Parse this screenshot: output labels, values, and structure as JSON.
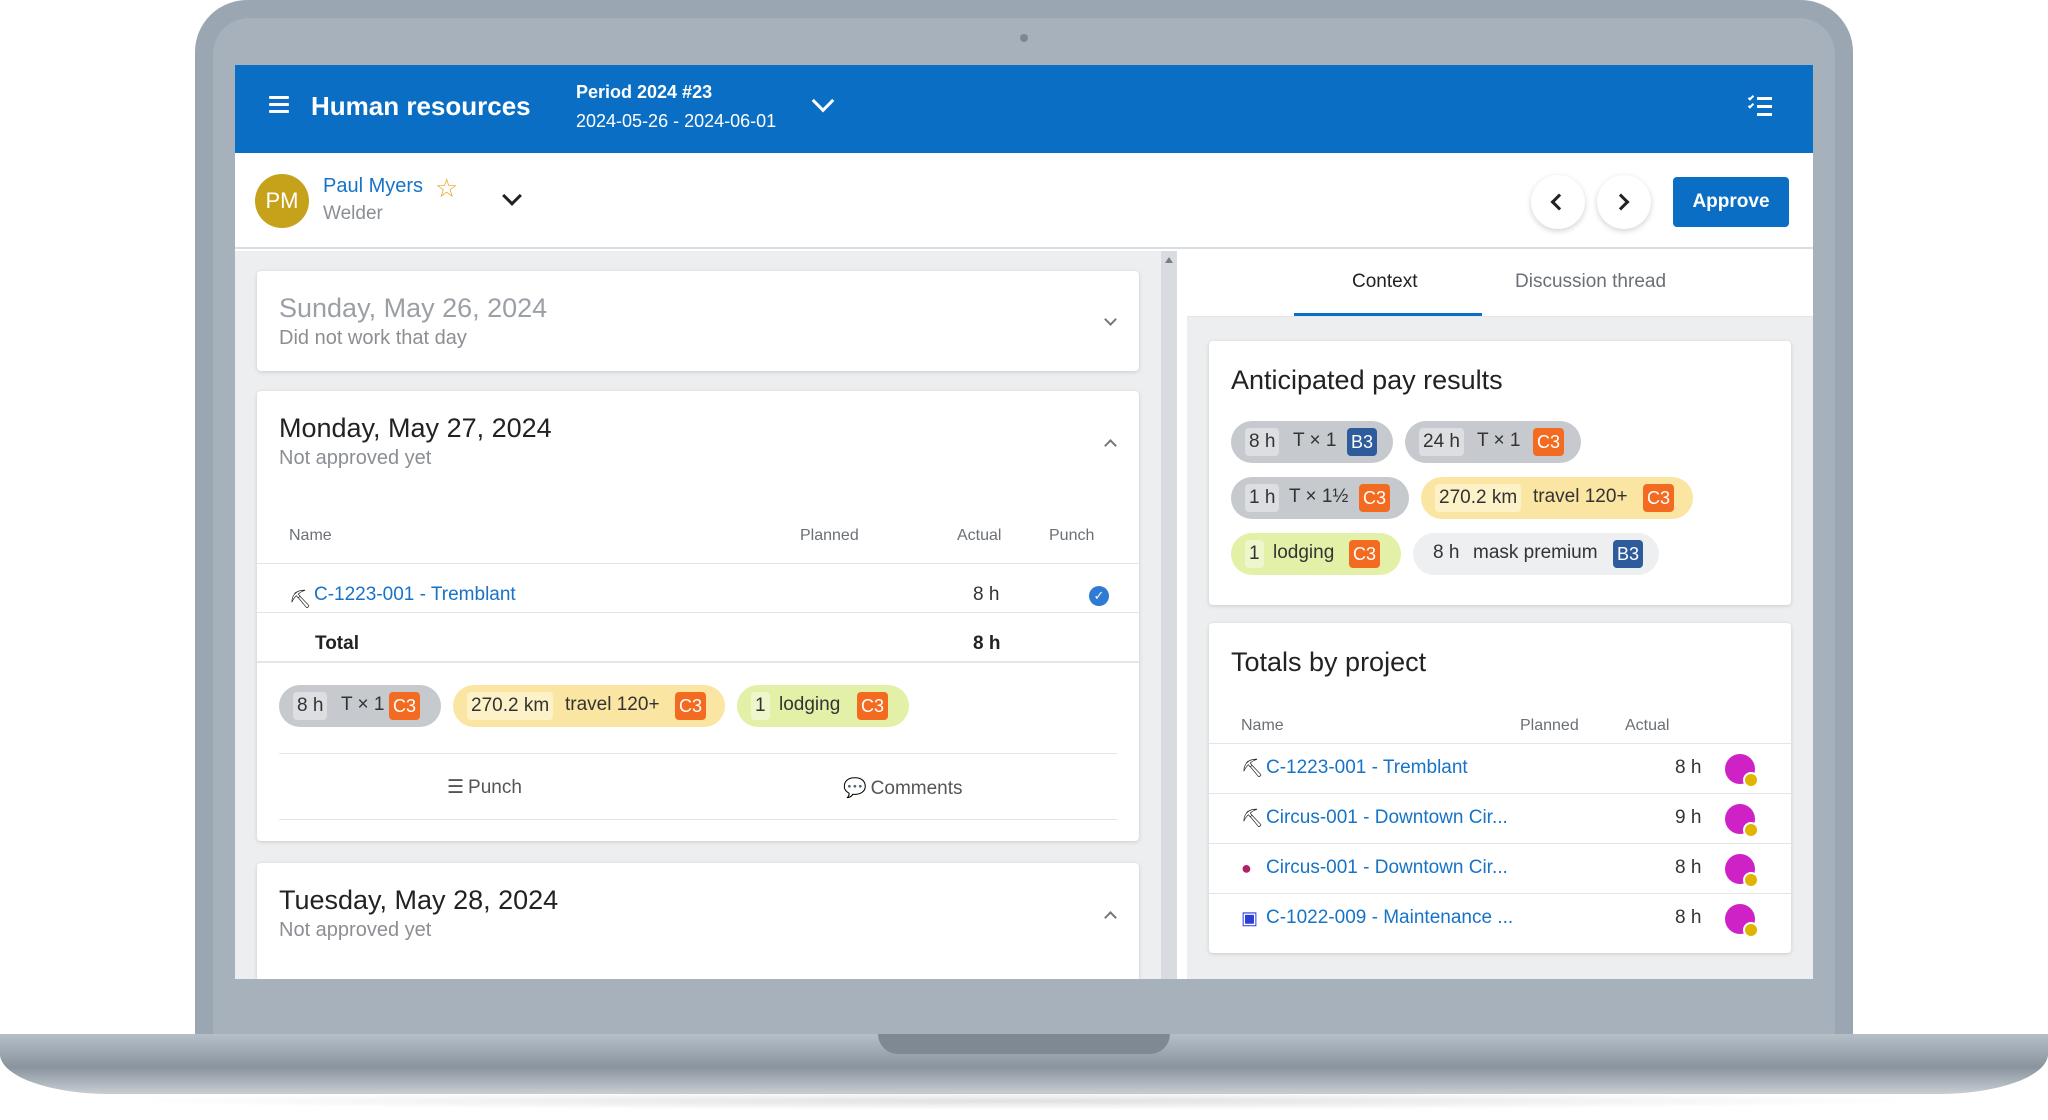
{
  "app": {
    "title": "Human resources",
    "period_title": "Period 2024 #23",
    "period_range": "2024-05-26 - 2024-06-01"
  },
  "user": {
    "initials": "PM",
    "name": "Paul Myers",
    "role": "Welder",
    "approve_label": "Approve"
  },
  "days": [
    {
      "title": "Sunday, May 26, 2024",
      "status": "Did not work that day"
    },
    {
      "title": "Monday, May 27, 2024",
      "status": "Not approved yet",
      "table": {
        "headers": [
          "Name",
          "Planned",
          "Actual",
          "Punch"
        ],
        "rows": [
          {
            "name": "C-1223-001 - Tremblant",
            "planned": "",
            "actual": "8 h"
          }
        ],
        "total_label": "Total",
        "total_actual": "8 h"
      },
      "chips": [
        {
          "qty": "8 h",
          "desc": "T × 1",
          "code": "C3"
        },
        {
          "qty": "270.2 km",
          "desc": "travel 120+",
          "code": "C3"
        },
        {
          "qty": "1",
          "desc": "lodging",
          "code": "C3"
        }
      ],
      "punch_label": "Punch",
      "comments_label": "Comments"
    },
    {
      "title": "Tuesday, May 28, 2024",
      "status": "Not approved yet"
    }
  ],
  "tabs": [
    "Context",
    "Discussion thread"
  ],
  "anticipated": {
    "title": "Anticipated pay results",
    "chips": [
      {
        "qty": "8 h",
        "desc": "T × 1",
        "code": "B3"
      },
      {
        "qty": "24 h",
        "desc": "T × 1",
        "code": "C3"
      },
      {
        "qty": "1 h",
        "desc": "T × 1½",
        "code": "C3"
      },
      {
        "qty": "270.2 km",
        "desc": "travel 120+",
        "code": "C3"
      },
      {
        "qty": "1",
        "desc": "lodging",
        "code": "C3"
      },
      {
        "qty": "8 h",
        "desc": "mask premium",
        "code": "B3"
      }
    ]
  },
  "totals": {
    "title": "Totals by project",
    "headers": [
      "Name",
      "Planned",
      "Actual"
    ],
    "rows": [
      {
        "name": "C-1223-001 - Tremblant",
        "actual": "8 h",
        "icon": "worker-icon"
      },
      {
        "name": "Circus-001 - Downtown Cir...",
        "actual": "9 h",
        "icon": "worker-icon"
      },
      {
        "name": "Circus-001 - Downtown Cir...",
        "actual": "8 h",
        "icon": "bomb-icon"
      },
      {
        "name": "C-1022-009 - Maintenance ...",
        "actual": "8 h",
        "icon": "monitor-icon"
      }
    ]
  },
  "colors": {
    "brand": "#0a6fc4",
    "link": "#1673c8",
    "code_c3": "#f26b21",
    "code_b3": "#2e5b9c",
    "avatar": "#c5a21a"
  }
}
